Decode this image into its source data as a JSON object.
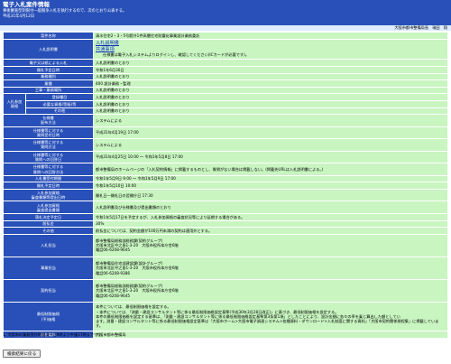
{
  "header": {
    "title": "電子入札案件情報",
    "line1": "事後審査型制限付一般競争入札を執行するので、次のとおり公表する。",
    "line2": "平成31年4月12日"
  },
  "dept_line": "大阪市都市整備局長　瑞田　翔",
  "rows": [
    {
      "label": "案件名称",
      "value": "清水住宅2・3・5号館外1件高層住宅耐震化事業設計業務委託"
    },
    {
      "label": "入札説明書",
      "type": "docs",
      "links": [
        "入札説明書",
        "共通事項"
      ],
      "note": "仕様書は電子入札システムよりログインし、確認してください(ICカードが必要です)。"
    },
    {
      "label": "電子又は紙による入札",
      "value": "入札説明書のとおり"
    },
    {
      "label": "開札予定日時",
      "value": "令和1年6月30日"
    },
    {
      "label": "業務種別",
      "value": "入札説明書のとおり"
    },
    {
      "label": "業種",
      "value": "400 設計業務・監理"
    },
    {
      "label": "工事・業務場所",
      "value": "入札説明書のとおり"
    }
  ],
  "group": {
    "label": "入札参加資格",
    "rows": [
      {
        "label": "登録種目",
        "value": "入札説明書のとおり"
      },
      {
        "label": "必要な資格(等級)等",
        "value": "入札説明書のとおり"
      },
      {
        "label": "その他",
        "value": "入札説明書のとおり"
      }
    ]
  },
  "rows2": [
    {
      "label": "仕様書\n配布方法",
      "value": "システムによる"
    },
    {
      "label": "仕様書等に対する\n質問受付日時",
      "value": "平成31年4月19日 17:00"
    },
    {
      "label": "仕様書等に対する\n質問方法",
      "value": "システムによる"
    },
    {
      "label": "仕様書等に対する\n質問への回答日",
      "value": "平成31年4月25日 10:00 ～ 令和1年5月8日 17:00"
    },
    {
      "label": "仕様書等に対する\n質問への回答方法",
      "value": "都市整備局のホームページの「入札契約情報」に掲載するものとし、質問がない場合は掲載しない。(掲載先URLは入札説明書による。)"
    },
    {
      "label": "入札書受付期間",
      "value": "令和1年5月9日 9:00 ～ 令和1年5月9日 17:00"
    },
    {
      "label": "開札予定日時",
      "value": "令和1年5月10日 10:00"
    },
    {
      "label": "入札参加資格\n審査書類等提出日時",
      "value": "開札日一開札日の翌開庁日 17:30"
    },
    {
      "label": "入札参加資格\n審査提出書類",
      "value": "入札説明書及び仕様書及び提出書類のとおり"
    },
    {
      "label": "落札決定予定日",
      "value": "令和1年5月17日を予定するが、入札参加資格の審査状況等により延期する場合がある。"
    },
    {
      "label": "前払金",
      "value": "30%"
    },
    {
      "label": "その他",
      "value": "前払金については、契約金額が100万円未満の契約は適用外とする。"
    },
    {
      "label": "入札担当",
      "type": "multi",
      "lines": [
        "都市整備局総務部総務課(契約グループ)",
        "大阪市北区中之島1-3-20　大阪市役所本庁舎6階",
        "電話06-6208-9645"
      ]
    },
    {
      "label": "事業担当",
      "type": "multi",
      "lines": [
        "都市整備局住宅部建設課(設計グループ)",
        "大阪市北区中之島1-3-20　大阪市役所本庁舎6階",
        "電話06-6208-9386"
      ]
    },
    {
      "label": "契約担当",
      "type": "multi",
      "lines": [
        "都市整備局総務部総務課(契約グループ)",
        "大阪市北区中之島1-3-20　大阪市役所本庁舎6階",
        "電話06-6208-9645"
      ]
    },
    {
      "label": "最低制限価格\n(予)価格",
      "type": "multi",
      "lines": [
        "本件については、最低制限価格を設定する。",
        "・本件については、「測量・建設コンサルタント等に係る最低制限価格設定基準(平成30年3月28日改正)」に基づき、最低制限価格を設定する。",
        "本件の最低制限価格を設定する基準は、「測量・建設コンサルタント等に係る最低制限価格設定基準第3条第1項」としたことにより、設計金額に各々の率を乗じ算出した額としてい",
        "ます。測量・建設コンサルタント等に係る最低制限価格設定基準は「大阪市ホーム>大阪市電子調達システム>各種資料・ダウンロード>入札制度に関する資料」「大阪市契約関係規程集」に掲載しています。"
      ]
    },
    {
      "label": "開札場所",
      "value": "大阪市都市整備局"
    }
  ],
  "footnote": "1. 大阪市の業務受付時間は平日9時より午後17時までです。",
  "back_button": "検索結果に戻る"
}
